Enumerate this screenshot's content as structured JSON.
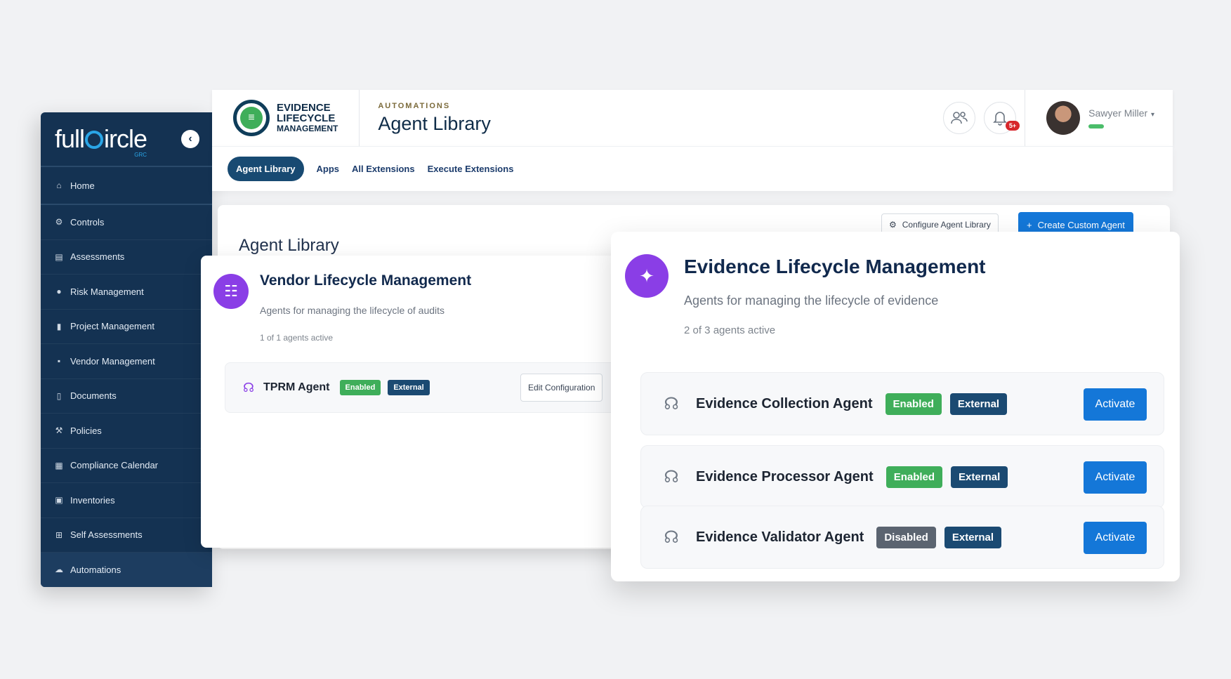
{
  "sidebar": {
    "logo": {
      "pre": "full",
      "post": "ircle",
      "sub": "GRC"
    },
    "items": [
      {
        "label": "Home",
        "icon": "home-icon"
      },
      {
        "label": "Controls",
        "icon": "gear-icon"
      },
      {
        "label": "Assessments",
        "icon": "clipboard-icon"
      },
      {
        "label": "Risk Management",
        "icon": "shield-icon"
      },
      {
        "label": "Project Management",
        "icon": "briefcase-icon"
      },
      {
        "label": "Vendor Management",
        "icon": "building-icon"
      },
      {
        "label": "Documents",
        "icon": "document-icon"
      },
      {
        "label": "Policies",
        "icon": "gavel-icon"
      },
      {
        "label": "Compliance Calendar",
        "icon": "calendar-icon"
      },
      {
        "label": "Inventories",
        "icon": "box-icon"
      },
      {
        "label": "Self Assessments",
        "icon": "grid-icon"
      },
      {
        "label": "Automations",
        "icon": "robot-icon"
      }
    ]
  },
  "header": {
    "module_lines": [
      "EVIDENCE",
      "LIFECYCLE",
      "MANAGEMENT"
    ],
    "eyebrow": "AUTOMATIONS",
    "title": "Agent Library",
    "notification_badge": "5+",
    "user_name": "Sawyer Miller"
  },
  "tabs": [
    "Agent Library",
    "Apps",
    "All Extensions",
    "Execute Extensions"
  ],
  "main": {
    "title": "Agent Library",
    "configure_label": "Configure Agent Library",
    "create_label": "Create Custom Agent"
  },
  "vendor": {
    "title": "Vendor Lifecycle Management",
    "desc": "Agents for managing the lifecycle of audits",
    "count": "1 of 1 agents active",
    "agent": {
      "name": "TPRM Agent",
      "status": "Enabled",
      "type": "External",
      "edit_label": "Edit Configuration"
    }
  },
  "evidence": {
    "title": "Evidence Lifecycle Management",
    "desc": "Agents for managing the lifecycle of evidence",
    "count": "2 of 3 agents active",
    "agents": [
      {
        "name": "Evidence Collection Agent",
        "status": "Enabled",
        "type": "External",
        "action": "Activate"
      },
      {
        "name": "Evidence Processor Agent",
        "status": "Enabled",
        "type": "External",
        "action": "Activate"
      },
      {
        "name": "Evidence Validator Agent",
        "status": "Disabled",
        "type": "External",
        "action": "Activate"
      }
    ]
  },
  "colors": {
    "sidebar": "#143252",
    "accent": "#1477d8",
    "enabled": "#3fae5a",
    "disabled": "#5b6470",
    "external": "#1b4a72",
    "category": "#8a3ee6"
  }
}
